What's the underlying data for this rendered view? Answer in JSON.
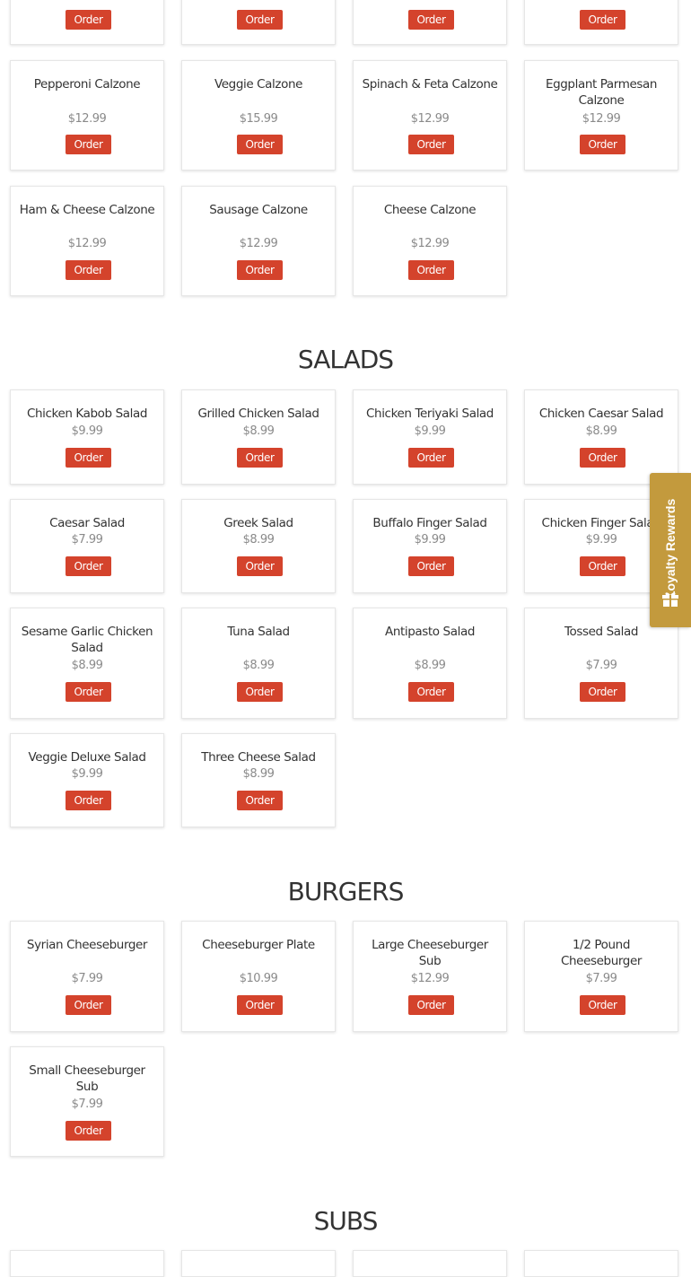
{
  "colors": {
    "accent": "#d4432c",
    "loyalty": "#c39a3d"
  },
  "order_label": "Order",
  "top_partial": {
    "items": [
      {
        "order": "Order"
      },
      {
        "order": "Order"
      },
      {
        "order": "Order"
      },
      {
        "order": "Order"
      }
    ]
  },
  "calzones": {
    "items": [
      {
        "name": "Pepperoni Calzone",
        "price": "$12.99",
        "order": "Order"
      },
      {
        "name": "Veggie Calzone",
        "price": "$15.99",
        "order": "Order"
      },
      {
        "name": "Spinach & Feta Calzone",
        "price": "$12.99",
        "order": "Order"
      },
      {
        "name": "Eggplant Parmesan Calzone",
        "price": "$12.99",
        "order": "Order"
      },
      {
        "name": "Ham & Cheese Calzone",
        "price": "$12.99",
        "order": "Order"
      },
      {
        "name": "Sausage Calzone",
        "price": "$12.99",
        "order": "Order"
      },
      {
        "name": "Cheese Calzone",
        "price": "$12.99",
        "order": "Order"
      }
    ]
  },
  "salads": {
    "title": "SALADS",
    "items": [
      {
        "name": "Chicken Kabob Salad",
        "price": "$9.99",
        "order": "Order"
      },
      {
        "name": "Grilled Chicken Salad",
        "price": "$8.99",
        "order": "Order"
      },
      {
        "name": "Chicken Teriyaki Salad",
        "price": "$9.99",
        "order": "Order"
      },
      {
        "name": "Chicken Caesar Salad",
        "price": "$8.99",
        "order": "Order"
      },
      {
        "name": "Caesar Salad",
        "price": "$7.99",
        "order": "Order"
      },
      {
        "name": "Greek Salad",
        "price": "$8.99",
        "order": "Order"
      },
      {
        "name": "Buffalo Finger Salad",
        "price": "$9.99",
        "order": "Order"
      },
      {
        "name": "Chicken Finger Salad",
        "price": "$9.99",
        "order": "Order"
      },
      {
        "name": "Sesame Garlic Chicken Salad",
        "price": "$8.99",
        "order": "Order"
      },
      {
        "name": "Tuna Salad",
        "price": "$8.99",
        "order": "Order"
      },
      {
        "name": "Antipasto Salad",
        "price": "$8.99",
        "order": "Order"
      },
      {
        "name": "Tossed Salad",
        "price": "$7.99",
        "order": "Order"
      },
      {
        "name": "Veggie Deluxe Salad",
        "price": "$9.99",
        "order": "Order"
      },
      {
        "name": "Three Cheese Salad",
        "price": "$8.99",
        "order": "Order"
      }
    ]
  },
  "burgers": {
    "title": "BURGERS",
    "items": [
      {
        "name": "Syrian Cheeseburger",
        "price": "$7.99",
        "order": "Order"
      },
      {
        "name": "Cheeseburger Plate",
        "price": "$10.99",
        "order": "Order"
      },
      {
        "name": "Large Cheeseburger Sub",
        "price": "$12.99",
        "order": "Order"
      },
      {
        "name": "1/2 Pound Cheeseburger",
        "price": "$7.99",
        "order": "Order"
      },
      {
        "name": "Small Cheeseburger Sub",
        "price": "$7.99",
        "order": "Order"
      }
    ]
  },
  "subs": {
    "title": "SUBS"
  },
  "loyalty": {
    "label": "Loyalty Rewards",
    "icon": "gift-icon"
  }
}
